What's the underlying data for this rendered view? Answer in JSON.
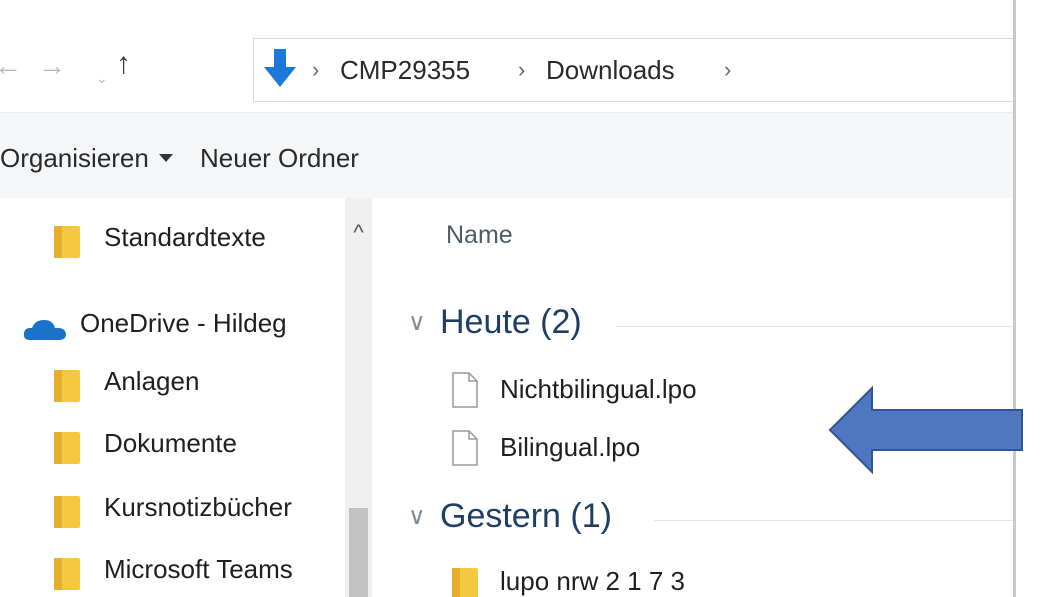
{
  "address_bar": {
    "nav": {
      "back_icon": "arrow-left-icon",
      "forward_icon": "arrow-right-icon",
      "recent_icon": "chevron-down-icon",
      "up_icon": "arrow-up-icon"
    },
    "location_icon": "downloads-arrow-icon",
    "breadcrumbs": [
      "CMP29355",
      "Downloads"
    ],
    "separator": "›"
  },
  "command_bar": {
    "organize_label": "Organisieren",
    "new_folder_label": "Neuer Ordner"
  },
  "nav_pane": {
    "items": [
      {
        "label": "Standardtexte",
        "icon": "folder-icon"
      },
      {
        "label": "OneDrive - Hildeg",
        "icon": "onedrive-cloud-icon"
      },
      {
        "label": "Anlagen",
        "icon": "folder-icon"
      },
      {
        "label": "Dokumente",
        "icon": "folder-icon"
      },
      {
        "label": "Kursnotizbücher",
        "icon": "folder-icon"
      },
      {
        "label": "Microsoft Teams",
        "icon": "folder-icon"
      }
    ]
  },
  "content": {
    "column_name": "Name",
    "groups": [
      {
        "title": "Heute (2)",
        "files": [
          {
            "name": "Nichtbilingual.lpo",
            "icon": "file-icon"
          },
          {
            "name": "Bilingual.lpo",
            "icon": "file-icon"
          }
        ]
      },
      {
        "title": "Gestern (1)",
        "files": [
          {
            "name": "lupo nrw 2 1 7 3",
            "icon": "folder-icon"
          }
        ]
      }
    ]
  },
  "colors": {
    "accent_blue": "#1e78d7",
    "group_title": "#1e3f63",
    "folder_yellow": "#f5c842",
    "annotation_arrow": "#4f77c0"
  }
}
